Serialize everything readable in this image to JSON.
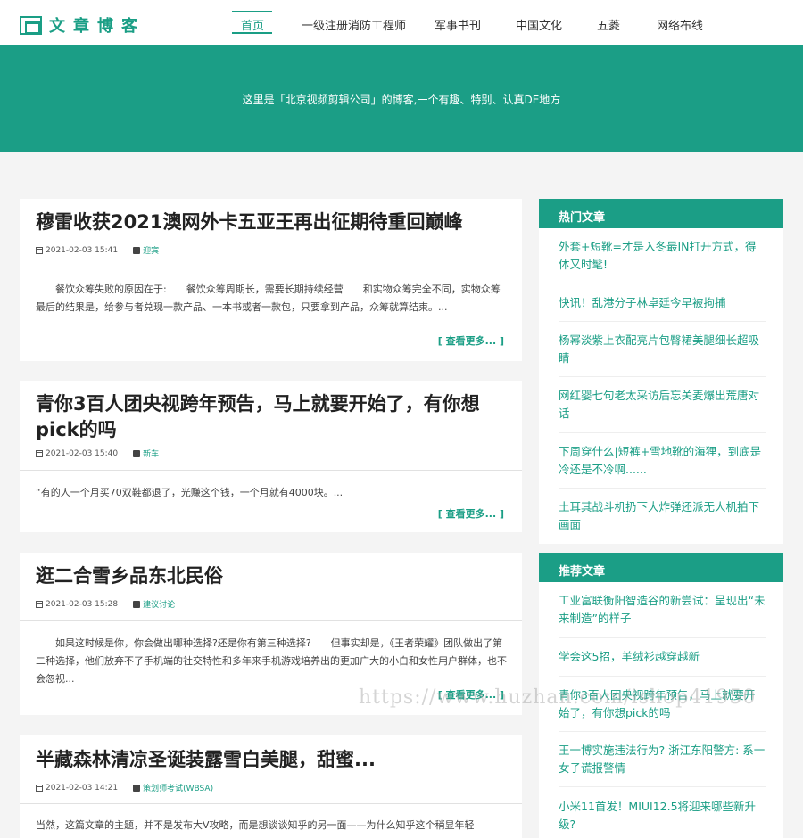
{
  "header": {
    "logo_text": "文章博客",
    "nav": [
      "首页",
      "一级注册消防工程师",
      "军事书刊",
      "中国文化",
      "五菱",
      "网络布线"
    ],
    "active_index": 0
  },
  "banner": {
    "tagline": "这里是「北京视频剪辑公司」的博客,一个有趣、特别、认真DE地方"
  },
  "articles": [
    {
      "title": "穆雷收获2021澳网外卡五亚王再出征期待重回巅峰",
      "date": "2021-02-03 15:41",
      "category": "迎宾",
      "excerpt": "餐饮众筹失败的原因在于:　　餐饮众筹周期长，需要长期持续经营　　和实物众筹完全不同，实物众筹最后的结果是，给参与者兑现一款产品、一本书或者一款包，只要拿到产品，众筹就算结束。...",
      "more": "[ 查看更多... ]"
    },
    {
      "title": "青你3百人团央视跨年预告，马上就要开始了，有你想pick的吗",
      "date": "2021-02-03 15:40",
      "category": "新车",
      "excerpt": "“有的人一个月买70双鞋都退了，光赚这个钱，一个月就有4000块。...",
      "more": "[ 查看更多... ]"
    },
    {
      "title": "逛二合雪乡品东北民俗",
      "date": "2021-02-03 15:28",
      "category": "建议讨论",
      "excerpt": "如果这时候是你，你会做出哪种选择?还是你有第三种选择?　　但事实却是，《王者荣耀》团队做出了第二种选择，他们放弃不了手机端的社交特性和多年来手机游戏培养出的更加广大的小白和女性用户群体，也不会忽视...",
      "more": "[ 查看更多... ]"
    },
    {
      "title": "半藏森林清凉圣诞装露雪白美腿，甜蜜...",
      "date": "2021-02-03 14:21",
      "category": "策划师考试(WBSA)",
      "excerpt": "当然，这篇文章的主题，并不是发布大V攻略，而是想谈谈知乎的另一面——为什么知乎这个稍显年轻"
    }
  ],
  "sidebar": {
    "hot": {
      "title": "热门文章",
      "items": [
        "外套+短靴=才是入冬最IN打开方式，得体又时髦!",
        "快讯！乱港分子林卓廷今早被拘捕",
        "杨幂淡紫上衣配亮片包臀裙美腿细长超吸睛",
        "网红婴七句老太采访后忘关麦爆出荒唐对话",
        "下周穿什么|短裤+雪地靴的海狸，到底是冷还是不冷啊......",
        "土耳其战斗机扔下大炸弹还派无人机拍下画面"
      ]
    },
    "recommended": {
      "title": "推荐文章",
      "items": [
        "工业富联衡阳智造谷的新尝试：呈现出“未来制造”的样子",
        "学会这5招，羊绒衫越穿越新",
        "青你3百人团央视跨年预告，马上就要开始了，有你想pick的吗",
        "王一博实施违法行为? 浙江东阳警方: 系一女子谎报警情",
        "小米11首发！MIUI12.5将迎来哪些新升级?"
      ]
    }
  },
  "watermark": "https://www.huzhan.com/ishop41950"
}
